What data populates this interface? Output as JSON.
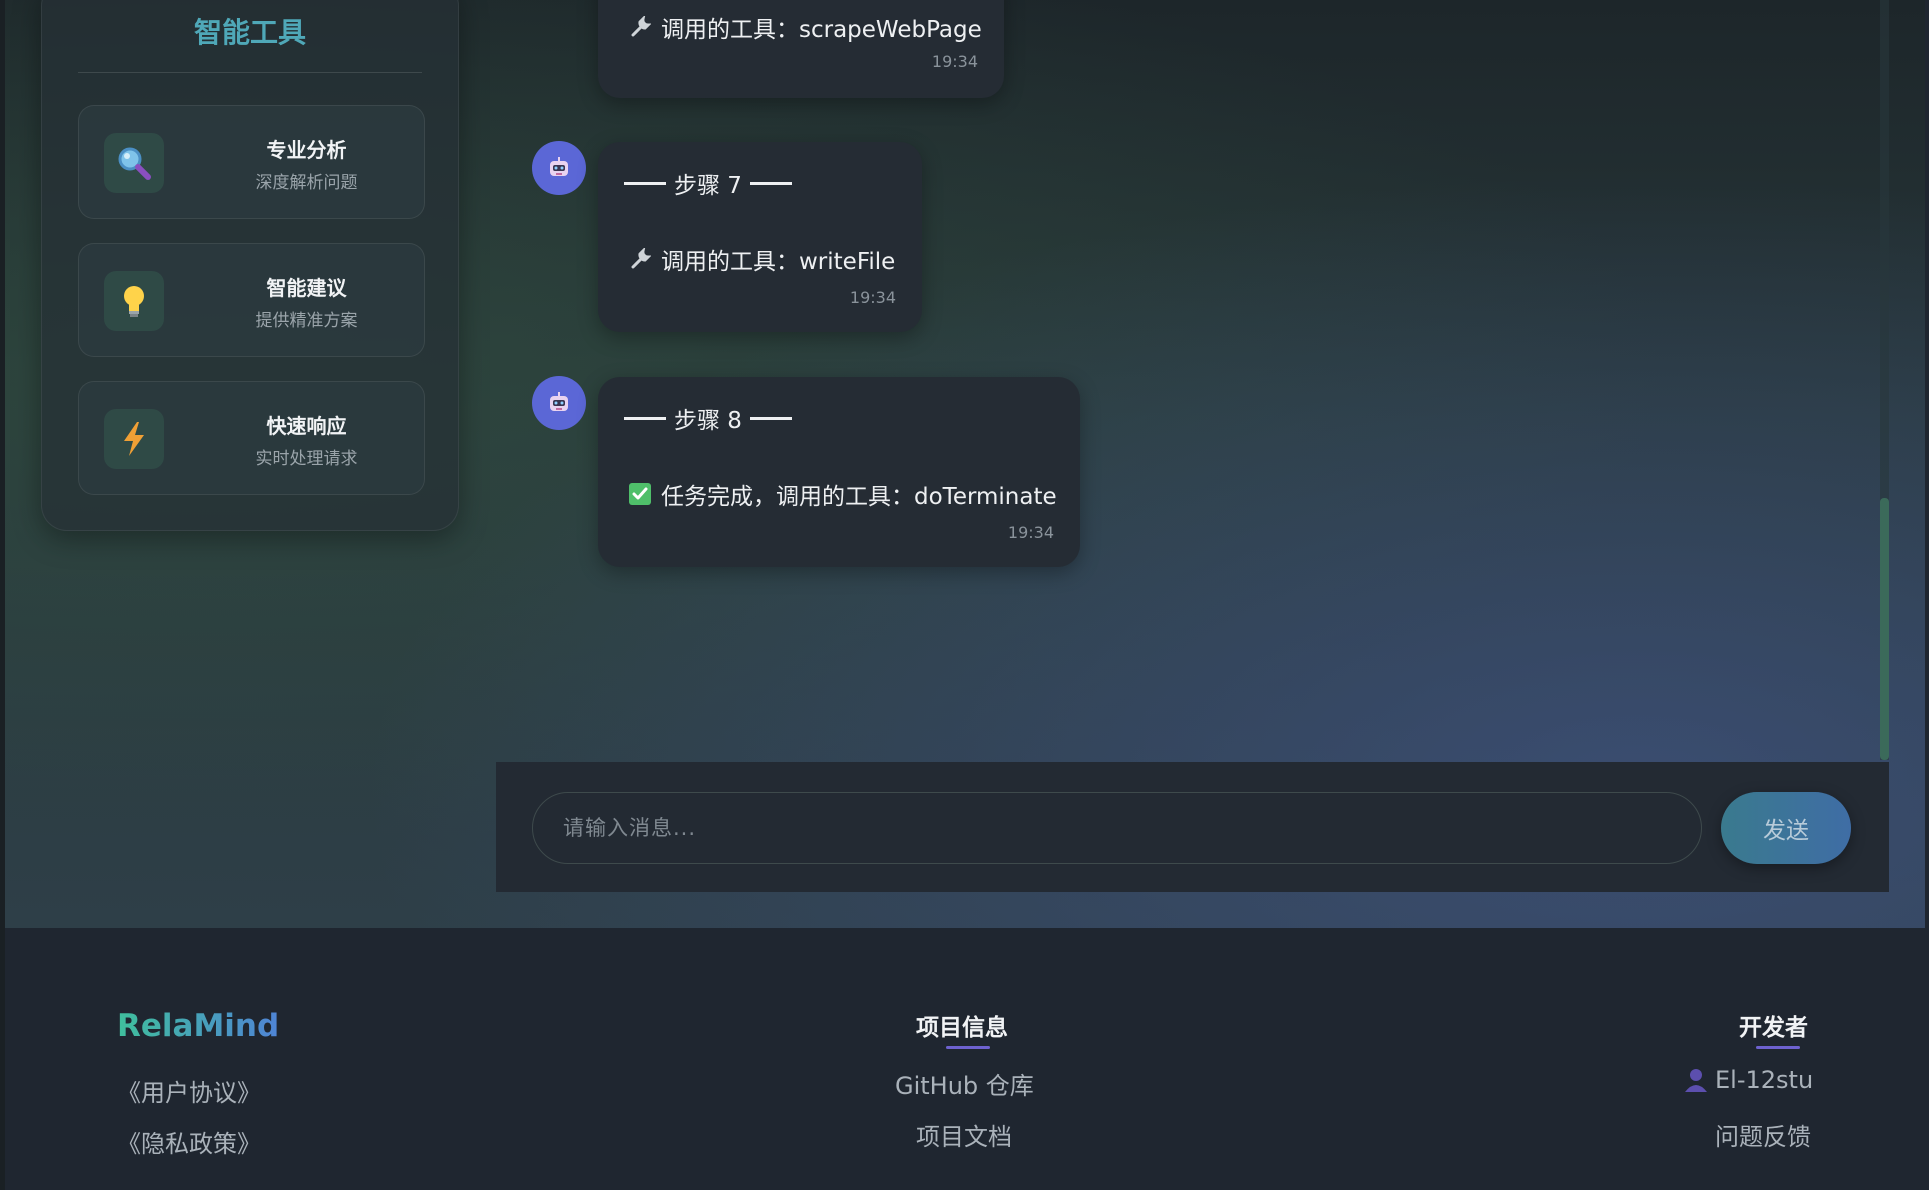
{
  "sidebar": {
    "title": "智能工具",
    "tools": [
      {
        "name": "专业分析",
        "desc": "深度解析问题",
        "icon": "magnifier-icon"
      },
      {
        "name": "智能建议",
        "desc": "提供精准方案",
        "icon": "lightbulb-icon"
      },
      {
        "name": "快速响应",
        "desc": "实时处理请求",
        "icon": "lightning-icon"
      }
    ]
  },
  "messages": [
    {
      "text": "调用的工具：scrapeWebPage",
      "time": "19:34",
      "icon": "wrench-icon"
    },
    {
      "step": "步骤 7",
      "text": "调用的工具：writeFile",
      "time": "19:34",
      "icon": "wrench-icon"
    },
    {
      "step": "步骤 8",
      "text": "任务完成，调用的工具：doTerminate",
      "time": "19:34",
      "icon": "check-icon"
    }
  ],
  "composer": {
    "placeholder": "请输入消息...",
    "send_label": "发送"
  },
  "footer": {
    "brand": "RelaMind",
    "legal": [
      "《用户协议》",
      "《隐私政策》"
    ],
    "project": {
      "heading": "项目信息",
      "links": [
        "GitHub 仓库",
        "项目文档"
      ]
    },
    "developer": {
      "heading": "开发者",
      "name": "El-12stu",
      "feedback": "问题反馈"
    }
  },
  "colors": {
    "accent": "#4fa8b8",
    "avatar": "#5b67d6",
    "send": "#3f6da5"
  }
}
